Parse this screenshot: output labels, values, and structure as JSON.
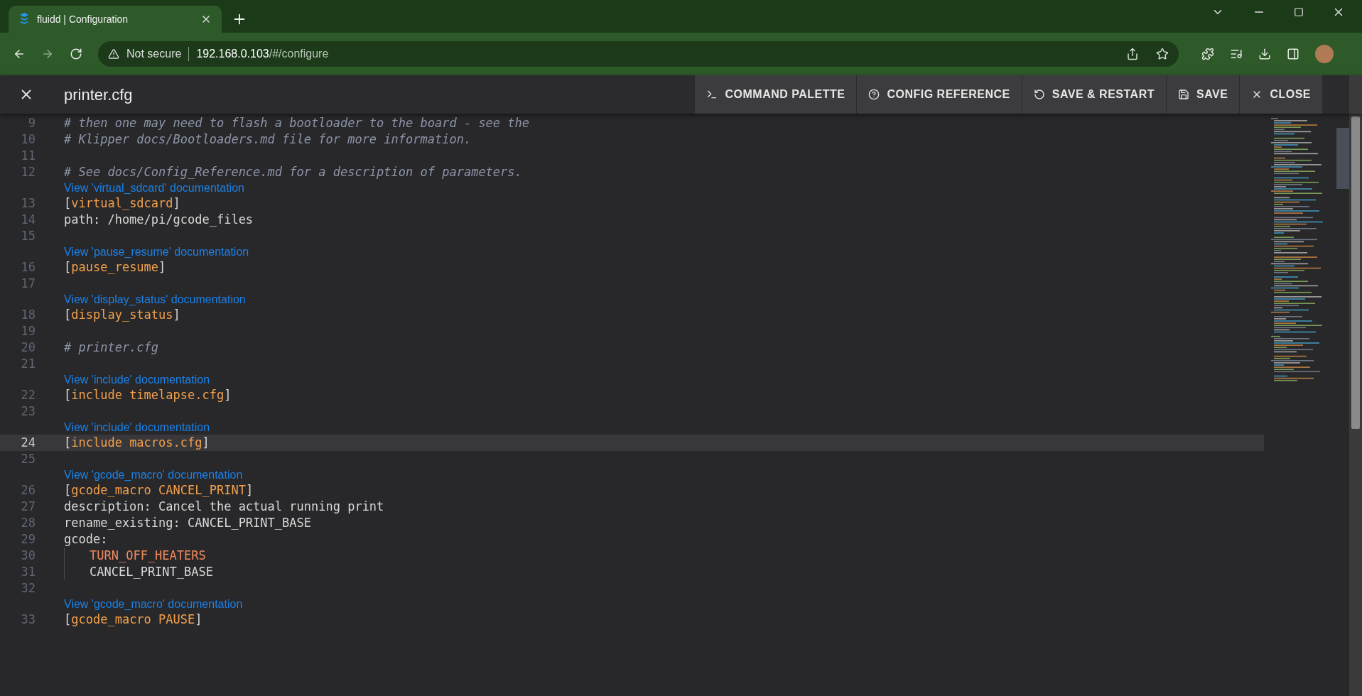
{
  "browser": {
    "tab": {
      "title": "fluidd | Configuration"
    },
    "address": {
      "security": "Not secure",
      "host": "192.168.0.103",
      "path": "/#/configure"
    }
  },
  "app_bar": {
    "title": "printer.cfg",
    "actions": [
      {
        "kind": "terminal",
        "label": "COMMAND PALETTE"
      },
      {
        "kind": "help",
        "label": "CONFIG REFERENCE"
      },
      {
        "kind": "restart",
        "label": "SAVE & RESTART"
      },
      {
        "kind": "save",
        "label": "SAVE"
      },
      {
        "kind": "close",
        "label": "CLOSE"
      }
    ]
  },
  "editor": {
    "lines": [
      {
        "number": "9",
        "current": false,
        "indented": false,
        "segments": [
          {
            "kind": "comment",
            "text": "# then one may need to flash a bootloader to the board - see the"
          }
        ]
      },
      {
        "number": "10",
        "current": false,
        "indented": false,
        "segments": [
          {
            "kind": "comment",
            "text": "# Klipper docs/Bootloaders.md file for more information."
          }
        ]
      },
      {
        "number": "11",
        "current": false,
        "indented": false
      },
      {
        "number": "12",
        "current": false,
        "indented": false,
        "segments": [
          {
            "kind": "comment",
            "text": "# See docs/Config_Reference.md for a description of parameters."
          }
        ]
      },
      {
        "number": "13",
        "current": false,
        "indented": false,
        "doc_link": "View 'virtual_sdcard' documentation",
        "segments": [
          {
            "kind": "plain",
            "text": "["
          },
          {
            "kind": "section",
            "text": "virtual_sdcard"
          },
          {
            "kind": "plain",
            "text": "]"
          }
        ]
      },
      {
        "number": "14",
        "current": false,
        "indented": false,
        "segments": [
          {
            "kind": "plain",
            "text": "path: /home/pi/gcode_files"
          }
        ]
      },
      {
        "number": "15",
        "current": false,
        "indented": false
      },
      {
        "number": "16",
        "current": false,
        "indented": false,
        "doc_link": "View 'pause_resume' documentation",
        "segments": [
          {
            "kind": "plain",
            "text": "["
          },
          {
            "kind": "section",
            "text": "pause_resume"
          },
          {
            "kind": "plain",
            "text": "]"
          }
        ]
      },
      {
        "number": "17",
        "current": false,
        "indented": false
      },
      {
        "number": "18",
        "current": false,
        "indented": false,
        "doc_link": "View 'display_status' documentation",
        "segments": [
          {
            "kind": "plain",
            "text": "["
          },
          {
            "kind": "section",
            "text": "display_status"
          },
          {
            "kind": "plain",
            "text": "]"
          }
        ]
      },
      {
        "number": "19",
        "current": false,
        "indented": false
      },
      {
        "number": "20",
        "current": false,
        "indented": false,
        "segments": [
          {
            "kind": "comment",
            "text": "# printer.cfg"
          }
        ]
      },
      {
        "number": "21",
        "current": false,
        "indented": false
      },
      {
        "number": "22",
        "current": false,
        "indented": false,
        "doc_link": "View 'include' documentation",
        "segments": [
          {
            "kind": "plain",
            "text": "["
          },
          {
            "kind": "section",
            "text": "include timelapse.cfg"
          },
          {
            "kind": "plain",
            "text": "]"
          }
        ]
      },
      {
        "number": "23",
        "current": false,
        "indented": false
      },
      {
        "number": "24",
        "current": true,
        "indented": false,
        "doc_link": "View 'include' documentation",
        "segments": [
          {
            "kind": "plain",
            "text": "["
          },
          {
            "kind": "section",
            "text": "include macros.cfg"
          },
          {
            "kind": "plain",
            "text": "]"
          }
        ]
      },
      {
        "number": "25",
        "current": false,
        "indented": false
      },
      {
        "number": "26",
        "current": false,
        "indented": false,
        "doc_link": "View 'gcode_macro' documentation",
        "segments": [
          {
            "kind": "plain",
            "text": "["
          },
          {
            "kind": "section",
            "text": "gcode_macro CANCEL_PRINT"
          },
          {
            "kind": "plain",
            "text": "]"
          }
        ]
      },
      {
        "number": "27",
        "current": false,
        "indented": false,
        "segments": [
          {
            "kind": "plain",
            "text": "description: Cancel the actual running print"
          }
        ]
      },
      {
        "number": "28",
        "current": false,
        "indented": false,
        "segments": [
          {
            "kind": "plain",
            "text": "rename_existing: CANCEL_PRINT_BASE"
          }
        ]
      },
      {
        "number": "29",
        "current": false,
        "indented": false,
        "segments": [
          {
            "kind": "plain",
            "text": "gcode:"
          }
        ]
      },
      {
        "number": "30",
        "current": false,
        "indented": true,
        "segments": [
          {
            "kind": "command",
            "text": "TURN_OFF_HEATERS"
          }
        ]
      },
      {
        "number": "31",
        "current": false,
        "indented": true,
        "segments": [
          {
            "kind": "plain",
            "text": "CANCEL_PRINT_BASE"
          }
        ]
      },
      {
        "number": "32",
        "current": false,
        "indented": false
      },
      {
        "number": "33",
        "current": false,
        "indented": false,
        "doc_link": "View 'gcode_macro' documentation",
        "segments": [
          {
            "kind": "plain",
            "text": "["
          },
          {
            "kind": "section",
            "text": "gcode_macro PAUSE"
          },
          {
            "kind": "plain",
            "text": "]"
          }
        ]
      }
    ]
  }
}
